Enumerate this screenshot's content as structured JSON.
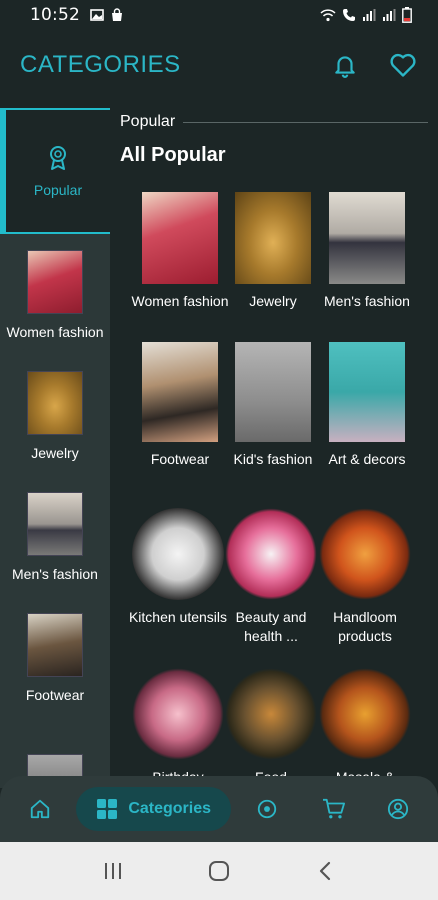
{
  "status_bar": {
    "time": "10:52"
  },
  "header": {
    "title": "CATEGORIES"
  },
  "sidebar": {
    "active": {
      "label": "Popular"
    },
    "items": [
      {
        "label": "Women fashion",
        "thumb_color": "#c2354a"
      },
      {
        "label": "Jewelry",
        "thumb_color": "#a77a2c"
      },
      {
        "label": "Men's fashion",
        "thumb_color": "#8a8a85"
      },
      {
        "label": "Footwear",
        "thumb_color": "#5a4a3c"
      },
      {
        "label": "",
        "thumb_color": "#6a6a6a"
      }
    ]
  },
  "content": {
    "section_name": "Popular",
    "section_title": "All Popular",
    "categories": [
      {
        "label": "Women fashion",
        "color": "#c2354a"
      },
      {
        "label": "Jewelry",
        "color": "#a77a2c"
      },
      {
        "label": "Men's fashion",
        "color": "#8a8a85"
      },
      {
        "label": "Footwear",
        "color": "#6b5640"
      },
      {
        "label": "Kid's fashion",
        "color": "#8d8d8d"
      },
      {
        "label": "Art & decors",
        "color": "#3aa8a8"
      },
      {
        "label": "Kitchen utensils",
        "color": "#e8e8e8"
      },
      {
        "label": "Beauty and health ...",
        "color": "#e66e9a"
      },
      {
        "label": "Handloom products",
        "color": "#d0541c"
      },
      {
        "label": "Birthday",
        "color": "#c86a86"
      },
      {
        "label": "Food",
        "color": "#6a5230"
      },
      {
        "label": "Masala &",
        "color": "#b4541c"
      }
    ]
  },
  "bottom_nav": {
    "active_label": "Categories",
    "icons": [
      "home-icon",
      "categories-grid-icon",
      "target-icon",
      "cart-icon",
      "profile-icon"
    ]
  },
  "colors": {
    "accent": "#2bb6c6",
    "background": "#1c2626",
    "sidebar": "#2c3838"
  }
}
